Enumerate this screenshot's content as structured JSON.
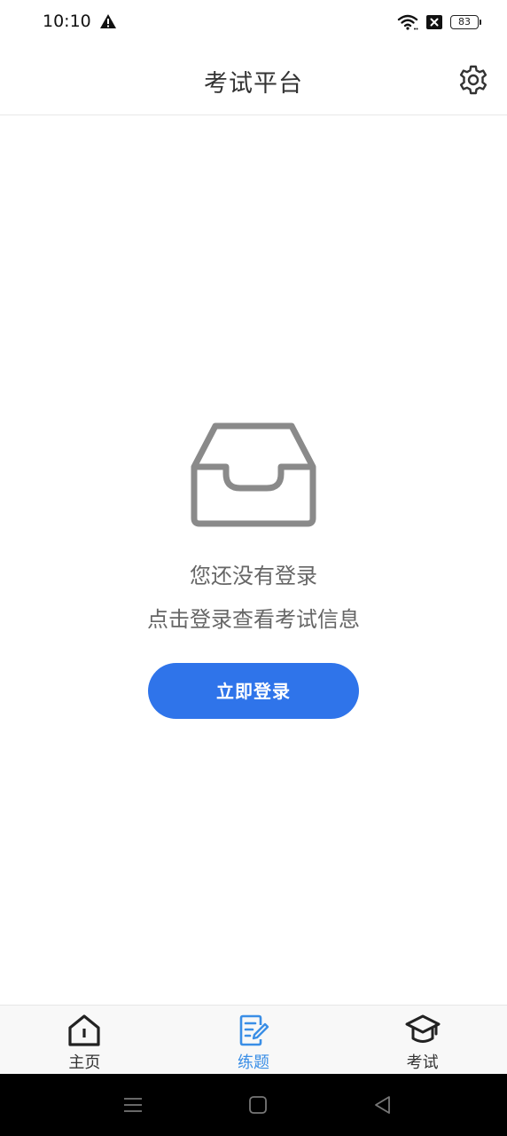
{
  "status_bar": {
    "time": "10:10",
    "battery": "83",
    "icons": [
      "warning-icon",
      "wifi-icon",
      "sim-off-icon",
      "battery-icon"
    ]
  },
  "header": {
    "title": "考试平台",
    "settings_icon": "gear-icon"
  },
  "empty_state": {
    "icon": "inbox-icon",
    "line1": "您还没有登录",
    "line2": "点击登录查看考试信息",
    "login_button": "立即登录"
  },
  "tabs": [
    {
      "label": "主页",
      "icon": "home-icon",
      "active": false
    },
    {
      "label": "练题",
      "icon": "edit-note-icon",
      "active": true
    },
    {
      "label": "考试",
      "icon": "graduation-cap-icon",
      "active": false
    }
  ],
  "system_nav": {
    "icons": [
      "menu-icon",
      "home-square-icon",
      "back-triangle-icon"
    ]
  },
  "colors": {
    "accent": "#2f74ea",
    "tab_active": "#3a8ee6",
    "text_primary": "#333333",
    "text_secondary": "#666666",
    "icon_gray": "#8a8a8a"
  }
}
